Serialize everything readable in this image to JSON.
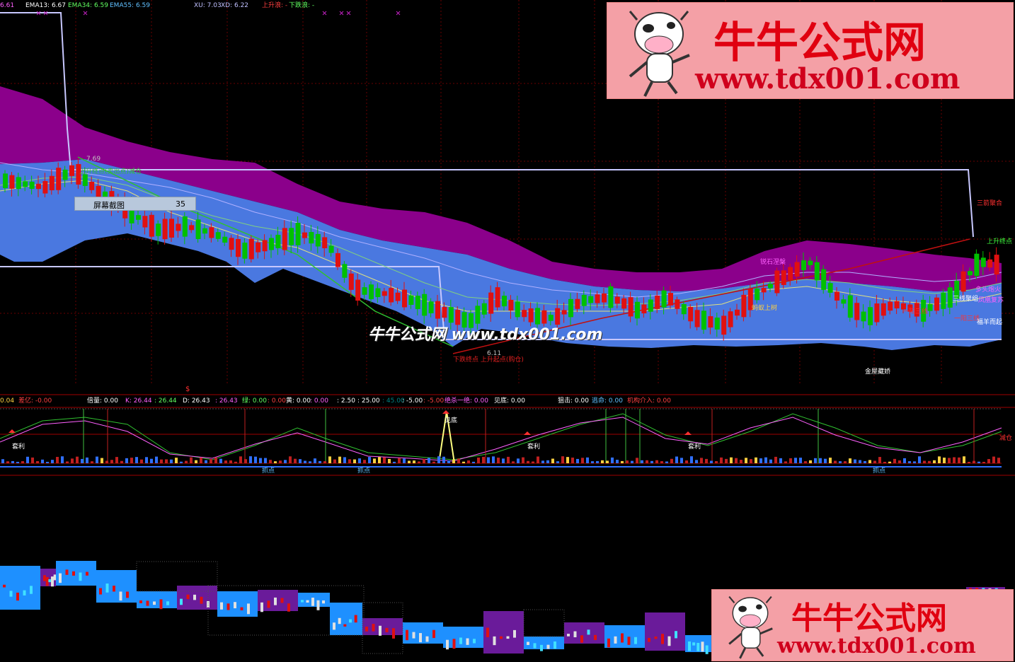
{
  "top_bar": {
    "value_left": "6.61",
    "ema13": "EMA13: 6.67",
    "ema34": "EMA34: 6.59",
    "ema55": "EMA55: 6.59",
    "xu": "XU: 7.03",
    "xd": "XD: 6.22",
    "up_trend": "上升浪: -",
    "down_trend": "下跌浪: -"
  },
  "main_chart": {
    "high_label": "7.69",
    "low_label": "6.11",
    "high_annotation": "上升终点(卖出点)减仓",
    "low_annotation": "下跌终点 上升起点(购仓)",
    "labels": {
      "jisheng": "锐石涅槃",
      "mayi": "蚂蚁上树",
      "sanjian": "三箭聚合",
      "shangsheng": "上升终点",
      "sanxian": "三线聚组",
      "yiyang1": "一阳三线",
      "yiyang2": "一阳三线",
      "fuyang": "福羊而起",
      "jinwu": "金屋藏娇",
      "duohuo": "多头炮火",
      "fengfu": "凤凰复苏"
    }
  },
  "tooltip": {
    "label": "屏幕截图",
    "value": "35"
  },
  "watermark": "牛牛公式网 www.tdx001.com",
  "logo": {
    "title": "牛牛公式网",
    "url": "www.tdx001.com"
  },
  "indicator_bar": {
    "v0": "0.04",
    "chayi": "差亿: -0.00",
    "beiliang": "倍量: 0.00",
    "k": "K: 26.44",
    "k2": ": 26.44",
    "d": "D: 26.43",
    "d2": ": 26.43",
    "lv": "绿: 0.00",
    "v1": ": 0.00",
    "huang": "黄: 0.00",
    "v2": ": 0.00",
    "v3": ": 2.50",
    "v4": ": 25.00",
    "v5": ": 45.00",
    "v6": ": -5.00",
    "v7": ": -5.00",
    "jueshi": "绝杀一绝: 0.00",
    "jiandi": "见底: 0.00",
    "jiji": "狙击: 0.00",
    "taoming": "逃命: 0.00",
    "jigou": "机构介入: 0.00"
  },
  "indicator_labels": {
    "taoli1": "套利",
    "taoli2": "套利",
    "taoli3": "套利",
    "jiandi": "见底",
    "jianjin": "减仓",
    "zhua1": "抓点",
    "zhua2": "抓点",
    "zhua3": "抓点",
    "dollar": "$"
  },
  "colors": {
    "magenta_band": "#8b008b",
    "blue_band": "#4a78e0",
    "candle_up": "#00c000",
    "candle_down": "#e01010",
    "bg": "#000000"
  }
}
